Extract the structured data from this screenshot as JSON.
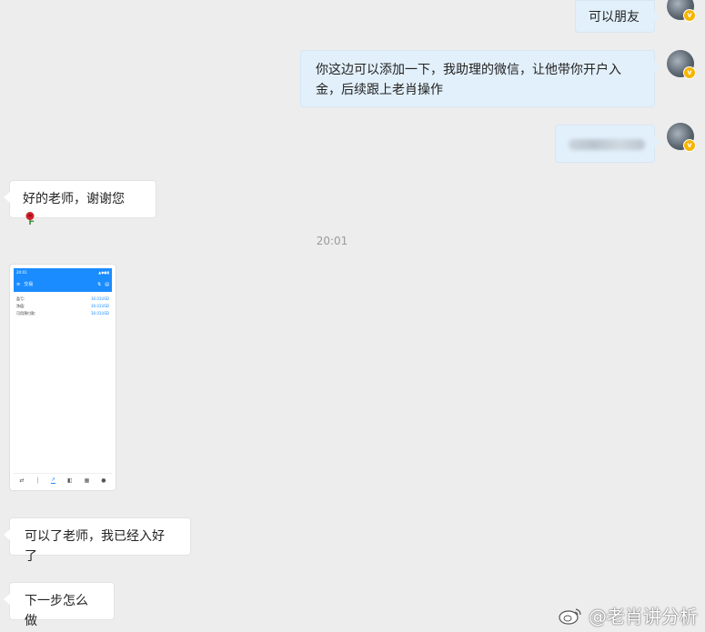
{
  "messages": {
    "m1": {
      "text": "可以朋友"
    },
    "m2": {
      "text": "你这边可以添加一下，我助理的微信，让他带你开户入金，后续跟上老肖操作"
    },
    "m4": {
      "text": "好的老师，谢谢您"
    },
    "timestamp": "20:01",
    "m6": {
      "text": "可以了老师，我已经入好了"
    },
    "m7": {
      "text": "下一步怎么做"
    }
  },
  "screenshot": {
    "status_time": "20:01",
    "title": "交易",
    "rows": [
      {
        "label": "盈亏:",
        "value": "30.01USD"
      },
      {
        "label": "净值:",
        "value": "30.01USD"
      },
      {
        "label": "可用预付款:",
        "value": "30.01USD"
      }
    ]
  },
  "watermark": {
    "text": "@老肖讲分析"
  },
  "colors": {
    "accent": "#1a8cff",
    "bubble_right": "#e2f0fb",
    "bubble_left": "#ffffff",
    "background": "#ededed"
  }
}
